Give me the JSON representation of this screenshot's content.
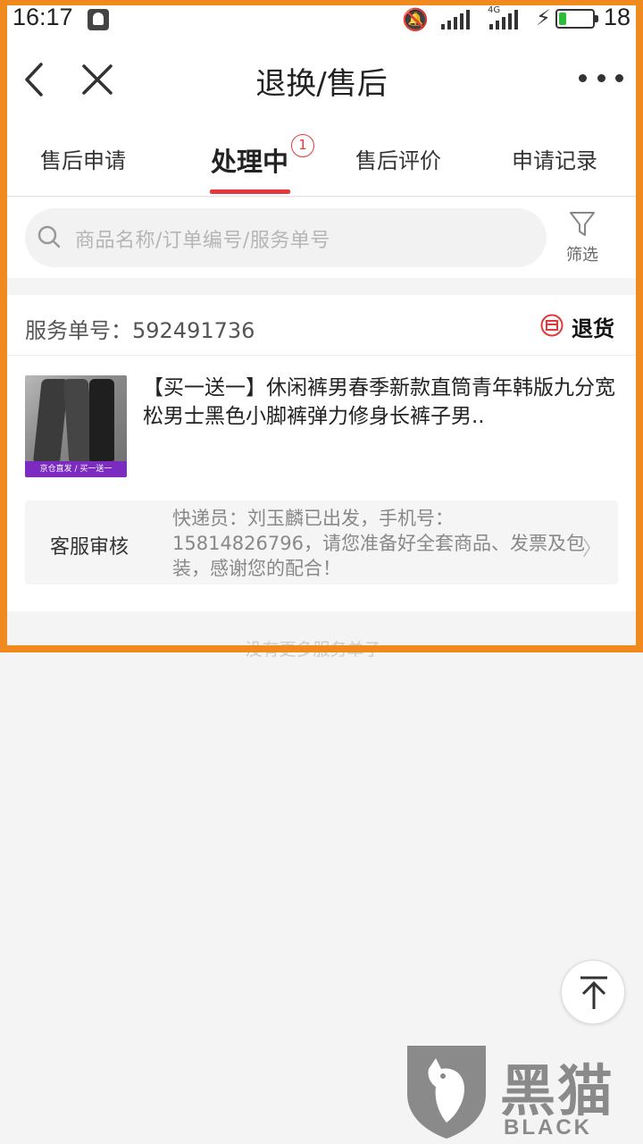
{
  "status_bar": {
    "time": "16:17",
    "network": "4G",
    "battery_level": "18",
    "battery_color": "#2dbb3a"
  },
  "nav": {
    "title": "退换/售后",
    "back_icon": "back-arrow-icon",
    "close_icon": "close-icon",
    "more_icon": "more-dots-icon"
  },
  "tabs": [
    {
      "label": "售后申请",
      "active": false
    },
    {
      "label": "处理中",
      "active": true,
      "badge": "1"
    },
    {
      "label": "售后评价",
      "active": false
    },
    {
      "label": "申请记录",
      "active": false
    }
  ],
  "search": {
    "placeholder": "商品名称/订单编号/服务单号",
    "filter_label": "筛选"
  },
  "service_order": {
    "number_label": "服务单号：",
    "number": "592491736",
    "type": "退货",
    "product": {
      "title": "【买一送一】休闲裤男春季新款直筒青年韩版九分宽松男士黑色小脚裤弹力修身长裤子男..",
      "image_banner": "京仓直发 / 买一送一"
    },
    "status": {
      "label": "客服审核",
      "message": "快递员：刘玉麟已出发，手机号：15814826796，请您准备好全套商品、发票及包装，感谢您的配合！"
    }
  },
  "footer_note": "没有更多服务单子～",
  "watermark": {
    "cn": "黑猫",
    "en": "BLACK CAT"
  },
  "colors": {
    "accent": "#e4393c",
    "frame": "#f08a1f"
  }
}
